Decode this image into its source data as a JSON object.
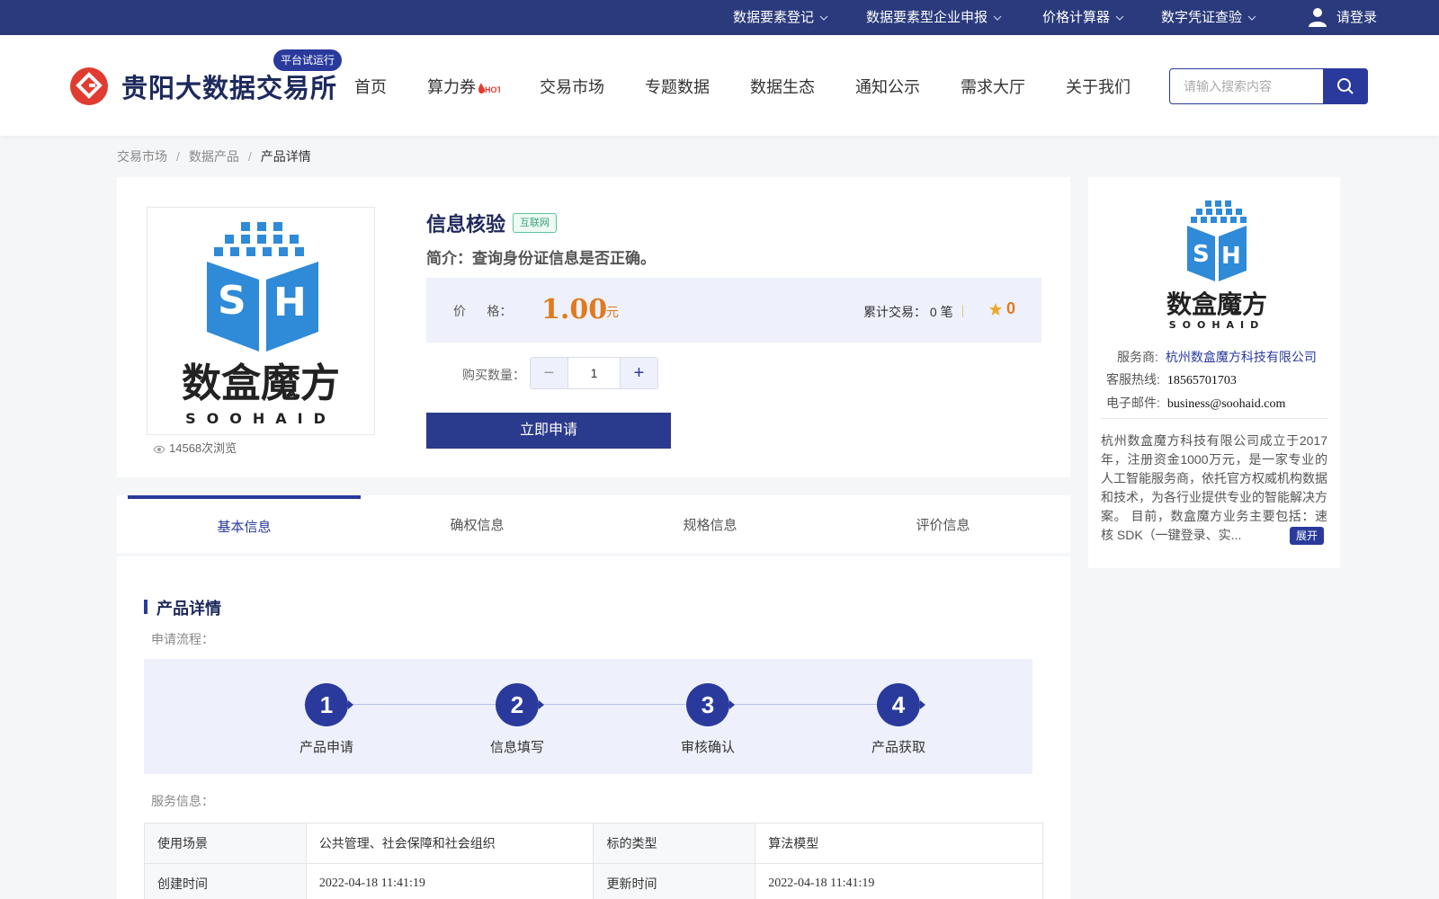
{
  "topbar": {
    "links": [
      {
        "label": "数据要素登记"
      },
      {
        "label": "数据要素型企业申报"
      },
      {
        "label": "价格计算器"
      },
      {
        "label": "数字凭证查验"
      }
    ],
    "login": "请登录"
  },
  "header": {
    "logo_text": "贵阳大数据交易所",
    "badge": "平台试运行",
    "nav": [
      "首页",
      "算力券",
      "交易市场",
      "专题数据",
      "数据生态",
      "通知公示",
      "需求大厅",
      "关于我们"
    ],
    "hot_tag": "HOT",
    "search_placeholder": "请输入搜索内容"
  },
  "breadcrumb": [
    "交易市场",
    "数据产品",
    "产品详情"
  ],
  "product": {
    "title": "信息核验",
    "tag": "互联网",
    "intro": "简介：查询身份证信息是否正确。",
    "price_label": "价      格：",
    "price": "1.00",
    "price_unit": "元",
    "trade_label": "累计交易：",
    "trade_count": "0 笔",
    "stars": "0",
    "qty_label": "购买数量：",
    "qty": "1",
    "apply": "立即申请",
    "views": "14568次浏览",
    "logo_cn": "数盒魔方",
    "logo_en": "SOOHAID"
  },
  "tabs": [
    "基本信息",
    "确权信息",
    "规格信息",
    "评价信息"
  ],
  "detail": {
    "title": "产品详情",
    "flow_label": "申请流程：",
    "steps": [
      {
        "num": "1",
        "label": "产品申请"
      },
      {
        "num": "2",
        "label": "信息填写"
      },
      {
        "num": "3",
        "label": "审核确认"
      },
      {
        "num": "4",
        "label": "产品获取"
      }
    ],
    "service_label": "服务信息：",
    "table": [
      [
        "使用场景",
        "公共管理、社会保障和社会组织",
        "标的类型",
        "算法模型"
      ],
      [
        "创建时间",
        "2022-04-18 11:41:19",
        "更新时间",
        "2022-04-18 11:41:19"
      ]
    ]
  },
  "seller": {
    "logo_cn": "数盒魔方",
    "logo_en": "SOOHAID",
    "provider_key": "服务商:",
    "provider": "杭州数盒魔方科技有限公司",
    "tel_key": "客服热线:",
    "tel": "18565701703",
    "mail_key": "电子邮件:",
    "mail": "business@soohaid.com",
    "desc": "杭州数盒魔方科技有限公司成立于2017年，注册资金1000万元，是一家专业的人工智能服务商，依托官方权威机构数据和技术，为各行业提供专业的智能解决方案。 目前，数盒魔方业务主要包括：速核 SDK（一键登录、实...",
    "expand": "展开"
  },
  "colors": {
    "primary": "#2a3a9c",
    "accent": "#e07a1f",
    "brand_red": "#e03c31"
  }
}
